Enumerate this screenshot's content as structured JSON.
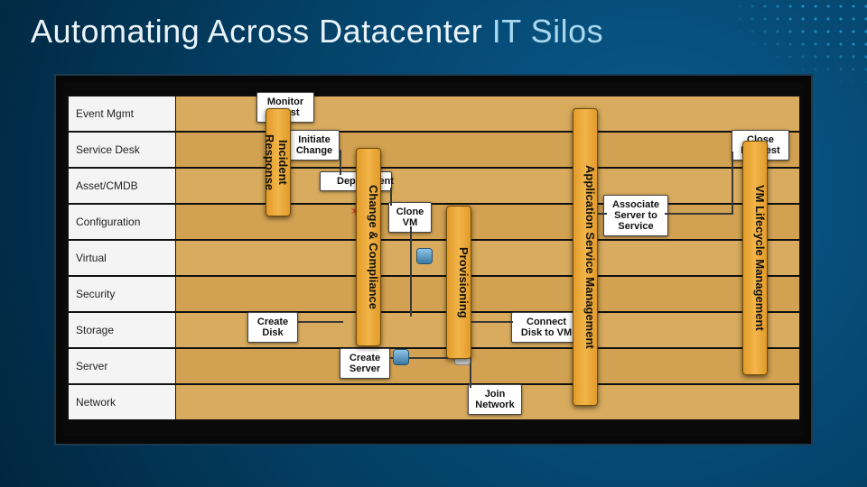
{
  "title_main": "Automating Across Datacenter ",
  "title_accent": "IT Silos",
  "silos": [
    "Event Mgmt",
    "Service Desk",
    "Asset/CMDB",
    "Configuration",
    "Virtual",
    "Security",
    "Storage",
    "Server",
    "Network"
  ],
  "pillars": {
    "incident": "Incident Response",
    "change": "Change & Compliance",
    "provisioning": "Provisioning",
    "asm": "Application Service Management",
    "vmlife": "VM Lifecycle Management"
  },
  "process": {
    "monitor_guest": "Monitor Guest",
    "initiate_change": "Initiate Change",
    "close_request": "Close Request",
    "deployment": "Deployment",
    "clone_vm": "Clone VM",
    "associate_server": "Associate Server to Service",
    "create_disk": "Create Disk",
    "connect_disk": "Connect Disk to VM",
    "create_server": "Create Server",
    "join_network": "Join Network"
  }
}
